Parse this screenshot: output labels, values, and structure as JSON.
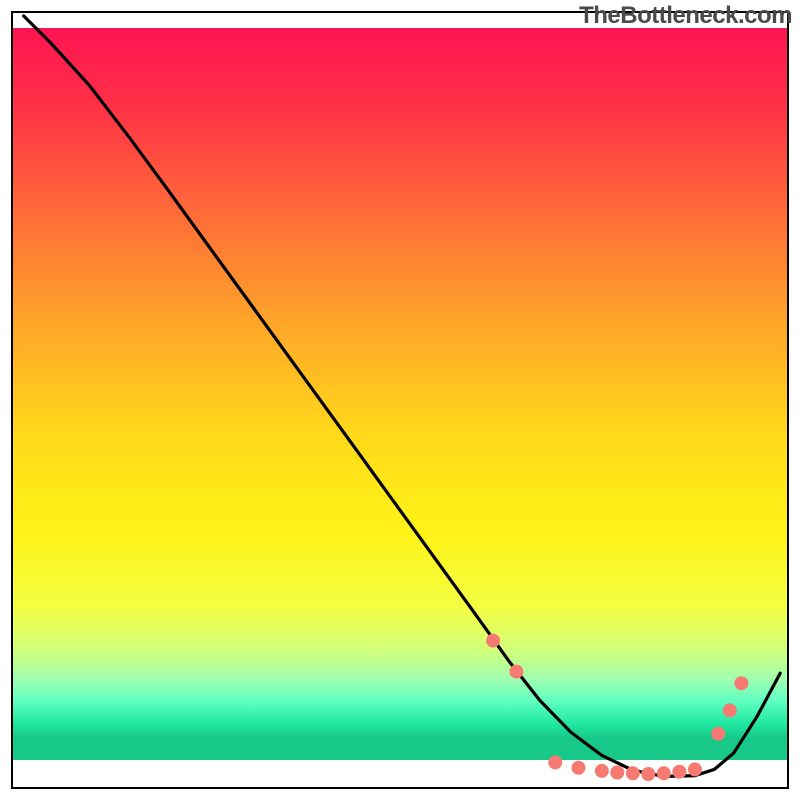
{
  "watermark": "TheBottleneck.com",
  "chart_data": {
    "type": "line",
    "title": "",
    "xlabel": "",
    "ylabel": "",
    "xlim": [
      0,
      100
    ],
    "ylim": [
      0,
      100
    ],
    "background_gradient": {
      "stops": [
        {
          "offset": 0.0,
          "color": "#ff1452"
        },
        {
          "offset": 0.1,
          "color": "#ff2f47"
        },
        {
          "offset": 0.25,
          "color": "#ff6b38"
        },
        {
          "offset": 0.4,
          "color": "#ffa629"
        },
        {
          "offset": 0.55,
          "color": "#ffd91a"
        },
        {
          "offset": 0.68,
          "color": "#fff217"
        },
        {
          "offset": 0.78,
          "color": "#f4ff40"
        },
        {
          "offset": 0.84,
          "color": "#d2ff7a"
        },
        {
          "offset": 0.88,
          "color": "#a0ffb0"
        },
        {
          "offset": 0.91,
          "color": "#5effc1"
        },
        {
          "offset": 0.94,
          "color": "#20e8a0"
        },
        {
          "offset": 0.96,
          "color": "#18c888"
        }
      ]
    },
    "series": [
      {
        "name": "bottleneck-curve",
        "x": [
          1.5,
          5,
          10,
          15,
          20,
          25,
          30,
          35,
          40,
          45,
          50,
          55,
          60,
          64,
          68,
          72,
          76,
          80,
          84,
          88,
          90.5,
          93,
          96,
          99
        ],
        "y": [
          99.5,
          96,
          90.5,
          84,
          77.2,
          70.3,
          63.4,
          56.5,
          49.6,
          42.7,
          35.8,
          28.9,
          22,
          16.4,
          11.3,
          7.2,
          4.2,
          2.3,
          1.5,
          1.6,
          2.4,
          4.5,
          9.2,
          14.8
        ]
      }
    ],
    "markers": {
      "name": "highlight-dots",
      "color": "#f77a72",
      "radius": 7,
      "points": [
        {
          "x": 62,
          "y": 19
        },
        {
          "x": 65,
          "y": 15
        },
        {
          "x": 70,
          "y": 3.3
        },
        {
          "x": 73,
          "y": 2.6
        },
        {
          "x": 76,
          "y": 2.2
        },
        {
          "x": 78,
          "y": 2.0
        },
        {
          "x": 80,
          "y": 1.9
        },
        {
          "x": 82,
          "y": 1.8
        },
        {
          "x": 84,
          "y": 1.9
        },
        {
          "x": 86,
          "y": 2.1
        },
        {
          "x": 88,
          "y": 2.4
        },
        {
          "x": 91,
          "y": 7
        },
        {
          "x": 92.5,
          "y": 10
        },
        {
          "x": 94,
          "y": 13.5
        }
      ]
    },
    "frame": {
      "stroke": "#000000",
      "width": 2
    }
  }
}
